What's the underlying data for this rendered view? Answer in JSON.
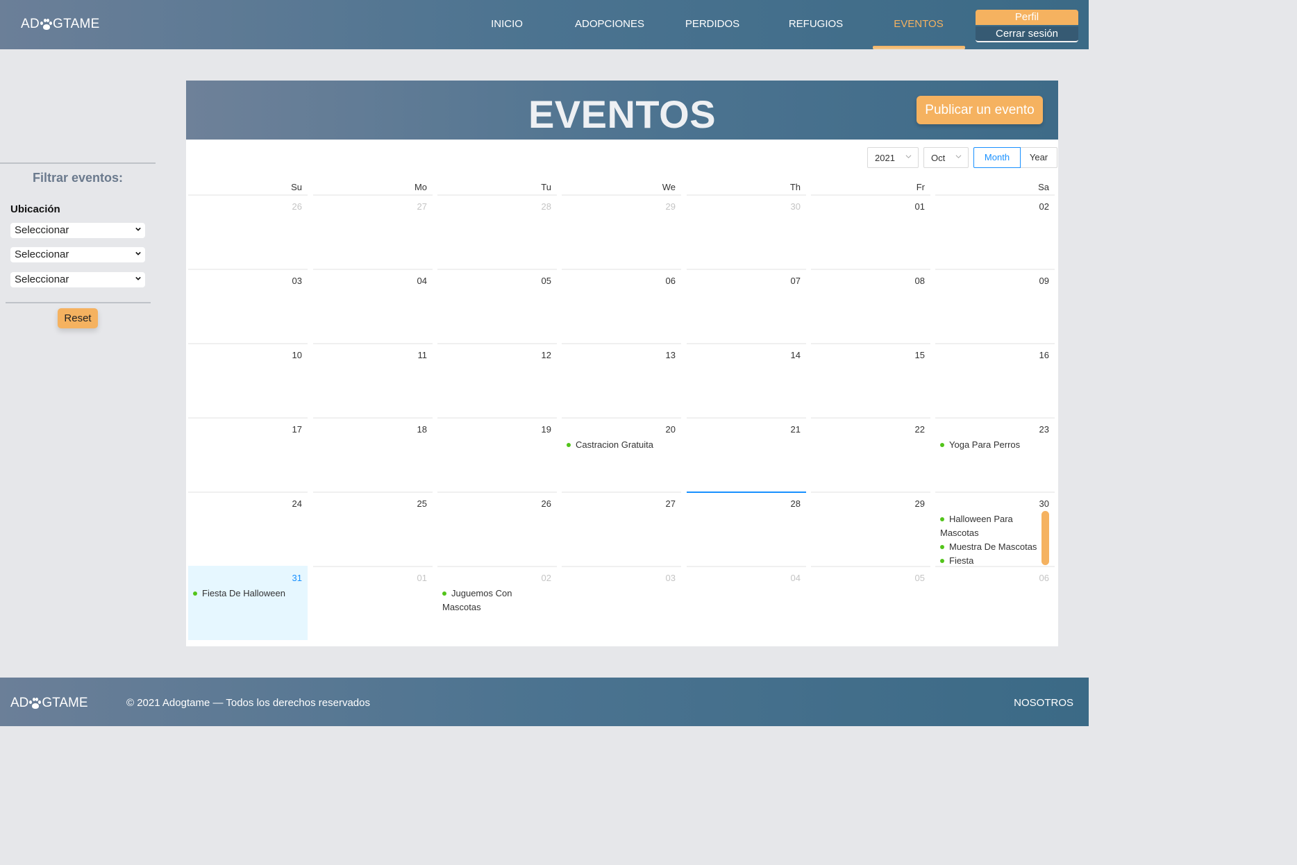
{
  "brand": {
    "logo_left": "AD",
    "logo_right": "GTAME"
  },
  "nav": {
    "items": [
      {
        "label": "INICIO"
      },
      {
        "label": "ADOPCIONES"
      },
      {
        "label": "PERDIDOS"
      },
      {
        "label": "REFUGIOS"
      },
      {
        "label": "EVENTOS"
      }
    ],
    "active": "EVENTOS",
    "perfil_label": "Perfil",
    "logout_label": "Cerrar sesión"
  },
  "sidebar": {
    "title": "Filtrar eventos:",
    "location_label": "Ubicación",
    "selects": [
      {
        "value": "Seleccionar"
      },
      {
        "value": "Seleccionar"
      },
      {
        "value": "Seleccionar"
      }
    ],
    "reset_label": "Reset"
  },
  "events": {
    "title": "EVENTOS",
    "publish_label": "Publicar un evento",
    "year": "2021",
    "month": "Oct",
    "mode_month": "Month",
    "mode_year": "Year",
    "weekdays": [
      "Su",
      "Mo",
      "Tu",
      "We",
      "Th",
      "Fr",
      "Sa"
    ],
    "weeks": [
      [
        {
          "d": "26",
          "o": true
        },
        {
          "d": "27",
          "o": true
        },
        {
          "d": "28",
          "o": true
        },
        {
          "d": "29",
          "o": true
        },
        {
          "d": "30",
          "o": true
        },
        {
          "d": "01"
        },
        {
          "d": "02"
        }
      ],
      [
        {
          "d": "03"
        },
        {
          "d": "04"
        },
        {
          "d": "05"
        },
        {
          "d": "06"
        },
        {
          "d": "07"
        },
        {
          "d": "08"
        },
        {
          "d": "09"
        }
      ],
      [
        {
          "d": "10"
        },
        {
          "d": "11"
        },
        {
          "d": "12"
        },
        {
          "d": "13"
        },
        {
          "d": "14"
        },
        {
          "d": "15"
        },
        {
          "d": "16"
        }
      ],
      [
        {
          "d": "17"
        },
        {
          "d": "18"
        },
        {
          "d": "19"
        },
        {
          "d": "20",
          "ev": [
            "Castracion Gratuita"
          ]
        },
        {
          "d": "21"
        },
        {
          "d": "22"
        },
        {
          "d": "23",
          "ev": [
            "Yoga Para Perros"
          ]
        }
      ],
      [
        {
          "d": "24"
        },
        {
          "d": "25"
        },
        {
          "d": "26"
        },
        {
          "d": "27"
        },
        {
          "d": "28",
          "hl": true
        },
        {
          "d": "29"
        },
        {
          "d": "30",
          "ev": [
            "Halloween Para Mascotas",
            "Muestra De Mascotas",
            "Fiesta"
          ]
        }
      ],
      [
        {
          "d": "31",
          "today": true,
          "ev": [
            "Fiesta De Halloween"
          ]
        },
        {
          "d": "01",
          "o": true
        },
        {
          "d": "02",
          "o": true,
          "ev": [
            "Juguemos Con Mascotas"
          ]
        },
        {
          "d": "03",
          "o": true
        },
        {
          "d": "04",
          "o": true
        },
        {
          "d": "05",
          "o": true
        },
        {
          "d": "06",
          "o": true
        }
      ]
    ]
  },
  "footer": {
    "logo_left": "AD",
    "logo_right": "GTAME",
    "copyright": "© 2021 Adogtame — Todos los derechos reservados",
    "about_label": "NOSOTROS"
  },
  "colors": {
    "accent": "#f5b260",
    "brand_dark": "#4b7390",
    "event_dot": "#52c41a",
    "link_blue": "#1890ff"
  }
}
